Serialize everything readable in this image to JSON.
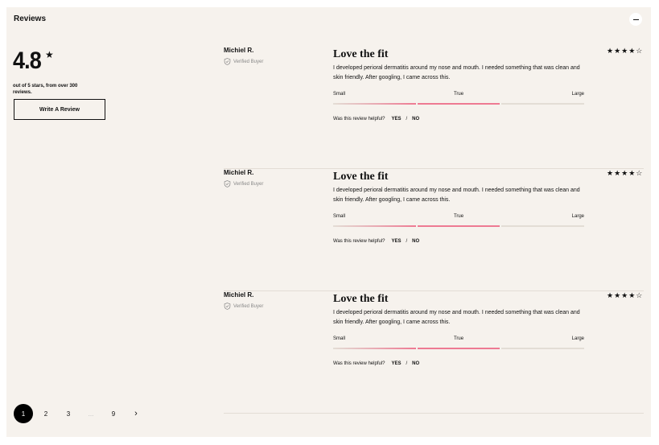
{
  "header": {
    "title": "Reviews"
  },
  "summary": {
    "average": "4.8",
    "star": "★",
    "subtitle": "out of 5 stars, from over 300 reviews.",
    "write_label": "Write A Review"
  },
  "reviews": [
    {
      "author": "Michiel R.",
      "verified": "Verified Buyer",
      "title": "Love the fit",
      "body": "I developed perioral dermatitis around my nose and mouth. I needed something that was clean and skin friendly. After googling, I came across this.",
      "stars": "★★★★☆",
      "rating": 4,
      "fit": {
        "small": "Small",
        "true": "True",
        "large": "Large",
        "value": "True"
      },
      "helpful_q": "Was this review helpful?",
      "yes": "YES",
      "slash": "/",
      "no": "NO"
    },
    {
      "author": "Michiel R.",
      "verified": "Verified Buyer",
      "title": "Love the fit",
      "body": "I developed perioral dermatitis around my nose and mouth. I needed something that was clean and skin friendly. After googling, I came across this.",
      "stars": "★★★★☆",
      "rating": 4,
      "fit": {
        "small": "Small",
        "true": "True",
        "large": "Large",
        "value": "True"
      },
      "helpful_q": "Was this review helpful?",
      "yes": "YES",
      "slash": "/",
      "no": "NO"
    },
    {
      "author": "Michiel R.",
      "verified": "Verified Buyer",
      "title": "Love the fit",
      "body": "I developed perioral dermatitis around my nose and mouth. I needed something that was clean and skin friendly. After googling, I came across this.",
      "stars": "★★★★☆",
      "rating": 4,
      "fit": {
        "small": "Small",
        "true": "True",
        "large": "Large",
        "value": "True"
      },
      "helpful_q": "Was this review helpful?",
      "yes": "YES",
      "slash": "/",
      "no": "NO"
    }
  ],
  "pagination": {
    "pages": [
      "1",
      "2",
      "3",
      "...",
      "9"
    ],
    "current": "1",
    "next": "›"
  },
  "colors": {
    "accent": "#ee7a93",
    "background": "#f6f2ed",
    "track": "#e3ddd5"
  }
}
